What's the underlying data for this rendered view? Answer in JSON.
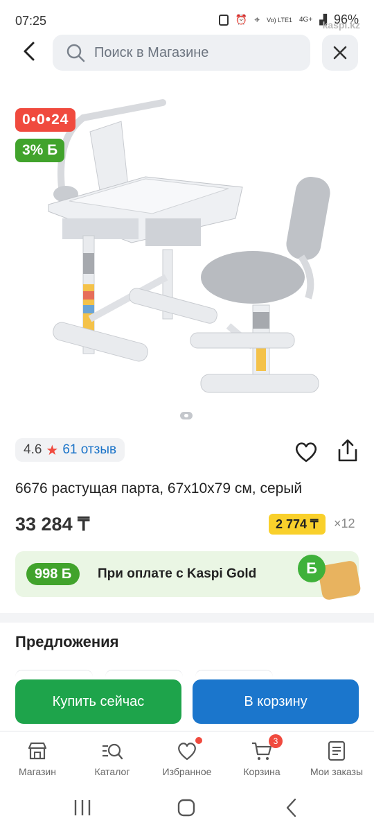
{
  "status_bar": {
    "time": "07:25",
    "network": "Vo) LTE1",
    "network_type": "4G+",
    "battery": "96%",
    "watermark": "kaspi.kz"
  },
  "header": {
    "search_placeholder": "Поиск в Магазине"
  },
  "product": {
    "timer_badge": "0•0•24",
    "bonus_badge": "3% Б",
    "rating": "4.6",
    "reviews": "61 отзыв",
    "title": "6676 растущая парта, 67x10x79 см, серый",
    "price": "33 284 ₸",
    "installment_amount": "2 774 ₸",
    "installment_months": "×12",
    "image_slide": {
      "current": 1,
      "total": 1
    }
  },
  "gold_banner": {
    "bonus": "998 Б",
    "text": "При оплате с Kaspi Gold",
    "coin": "Б"
  },
  "offers": {
    "title": "Предложения"
  },
  "actions": {
    "buy_now": "Купить сейчас",
    "add_to_cart": "В корзину"
  },
  "bottom_nav": {
    "items": [
      {
        "label": "Магазин",
        "icon": "shop-icon"
      },
      {
        "label": "Каталог",
        "icon": "catalog-search-icon"
      },
      {
        "label": "Избранное",
        "icon": "heart-icon"
      },
      {
        "label": "Корзина",
        "icon": "cart-icon",
        "badge": "3"
      },
      {
        "label": "Мои заказы",
        "icon": "orders-icon"
      }
    ]
  },
  "colors": {
    "accent_red": "#f04a3e",
    "accent_green": "#41a32c",
    "buy_green": "#1ea44b",
    "cart_blue": "#1b76cc",
    "installment_yellow": "#f9d02b"
  }
}
